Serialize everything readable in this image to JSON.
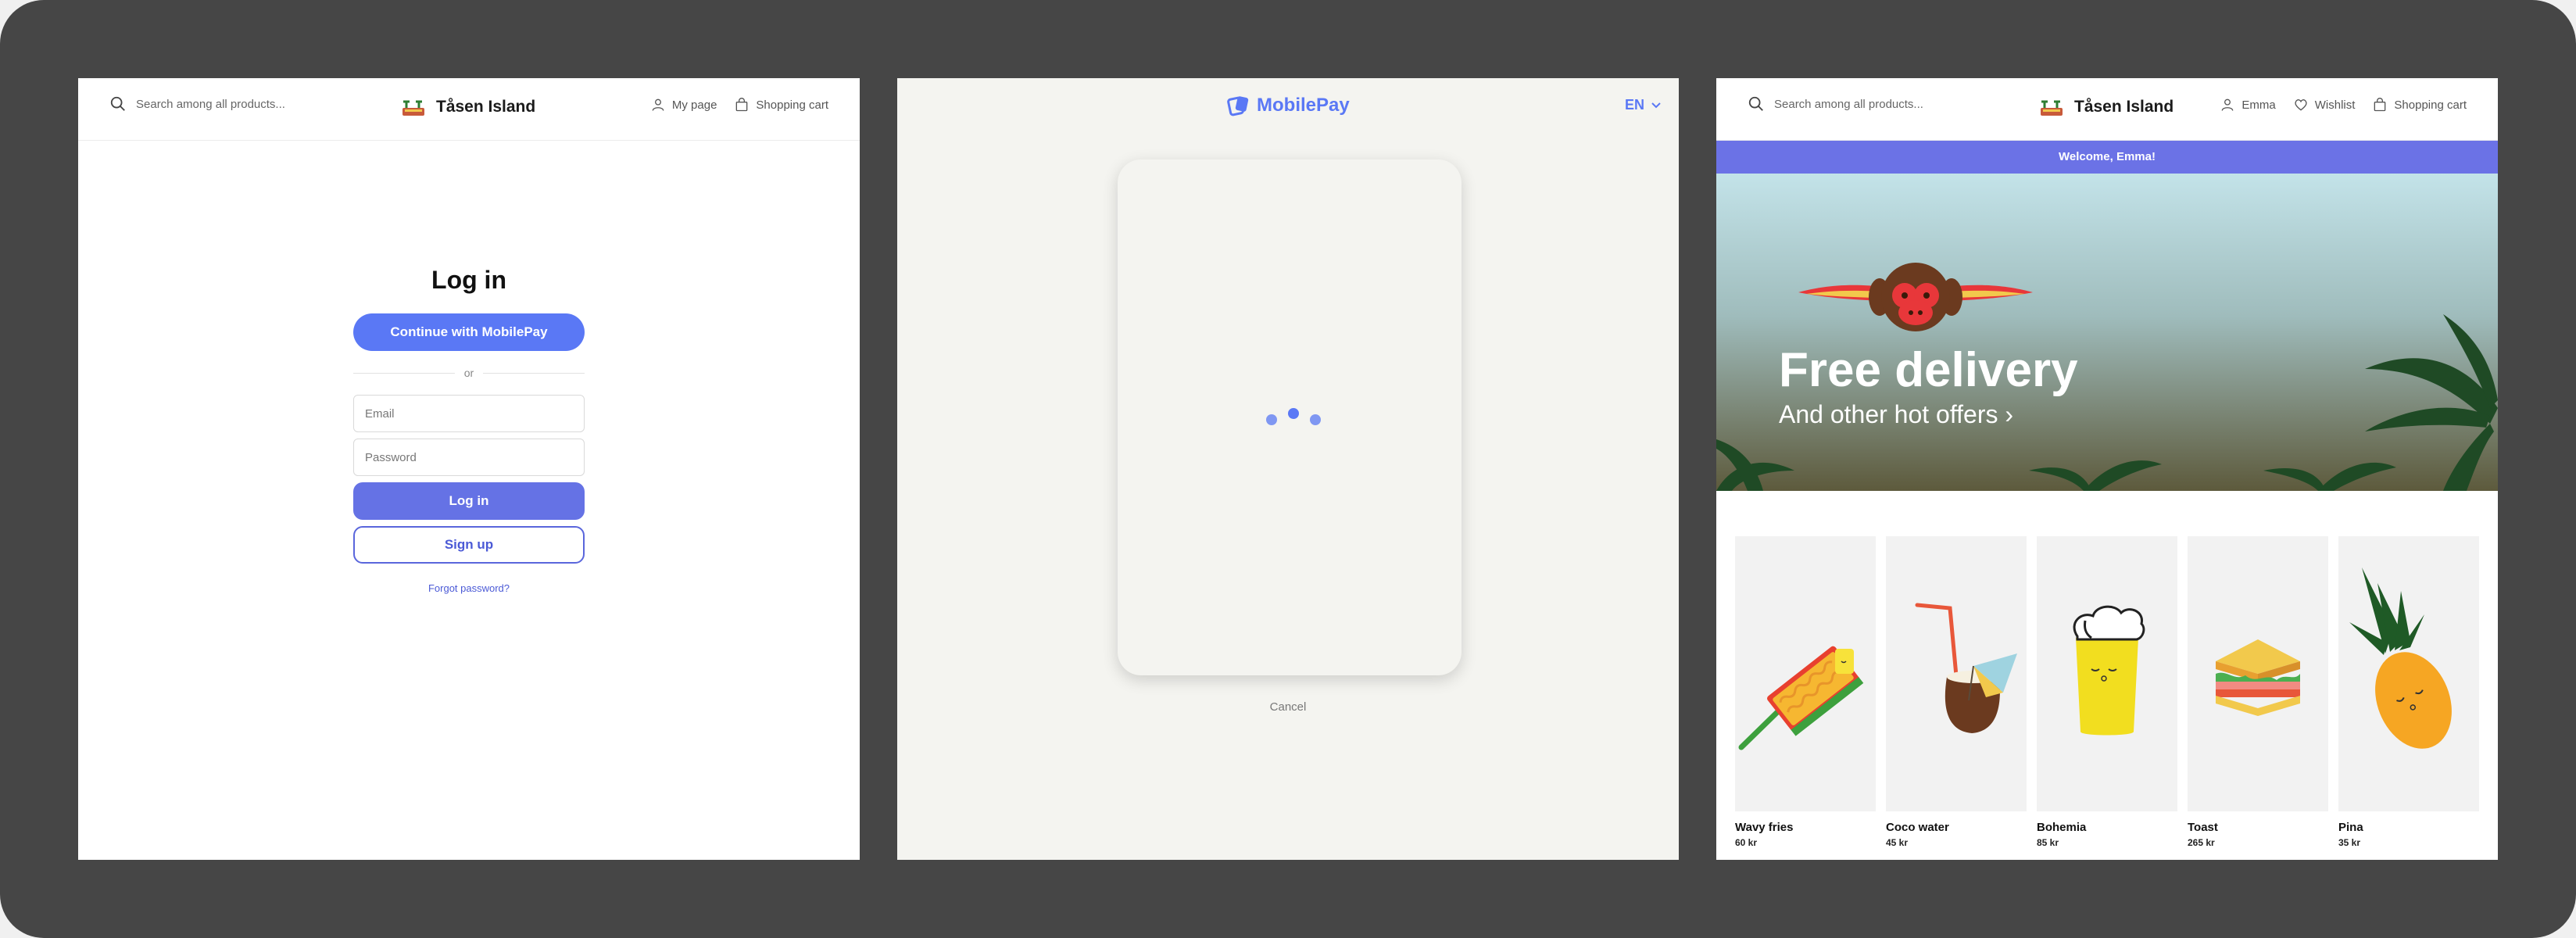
{
  "shop": {
    "brand": "Tåsen Island",
    "search_placeholder": "Search among all products..."
  },
  "login_panel": {
    "nav": {
      "my_page": "My page",
      "cart": "Shopping cart"
    },
    "title": "Log in",
    "mobilepay_button": "Continue with MobilePay",
    "or": "or",
    "email_placeholder": "Email",
    "password_placeholder": "Password",
    "login_button": "Log in",
    "signup_button": "Sign up",
    "forgot": "Forgot password?"
  },
  "mobilepay_panel": {
    "logo": "MobilePay",
    "language": "EN",
    "cancel": "Cancel"
  },
  "home_panel": {
    "nav": {
      "user": "Emma",
      "wishlist": "Wishlist",
      "cart": "Shopping cart"
    },
    "welcome": "Welcome, Emma!",
    "hero": {
      "title": "Free delivery",
      "subtitle": "And other hot offers ›"
    },
    "products": [
      {
        "name": "Wavy fries",
        "price": "60 kr"
      },
      {
        "name": "Coco water",
        "price": "45 kr"
      },
      {
        "name": "Bohemia",
        "price": "85 kr"
      },
      {
        "name": "Toast",
        "price": "265 kr"
      },
      {
        "name": "Pina",
        "price": "35 kr"
      }
    ]
  },
  "colors": {
    "mobilepay_blue": "#5a78f5",
    "primary": "#6572e5",
    "frame": "#464646"
  }
}
